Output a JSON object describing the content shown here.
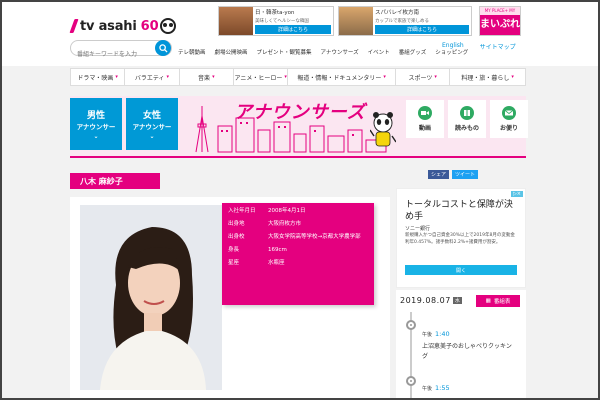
{
  "logo": {
    "text": "tv asahi",
    "sixty": "60"
  },
  "search": {
    "placeholder": "番組キーワードを入力"
  },
  "ads": [
    {
      "title": "日・韓茶ta-yon",
      "desc": "美味しくてヘルシーな韓国",
      "button": "詳細はこちら"
    },
    {
      "title": "スパバレイ枚方南",
      "desc": "カップルで家族で楽しめる",
      "button": "詳細はこちら"
    },
    {
      "top": "MY PLACE+ MY PLEASURE",
      "main": "まいぷれ"
    }
  ],
  "topnav": [
    "テレ朝動画",
    "劇場公開映画",
    "プレゼント・観覧募集",
    "アナウンサーズ",
    "イベント",
    "番組グッズ",
    "ショッピング"
  ],
  "util": {
    "english": "English",
    "sitemap": "サイトマップ"
  },
  "catnav": [
    "ドラマ・映画",
    "バラエティ",
    "音楽",
    "アニメ・ヒーロー",
    "報道・情報・ドキュメンタリー",
    "スポーツ",
    "料理・旅・暮らし"
  ],
  "announcer": {
    "male": {
      "l1": "男性",
      "l2": "アナウンサー"
    },
    "female": {
      "l1": "女性",
      "l2": "アナウンサー"
    },
    "title": "アナウンサーズ",
    "icons": [
      {
        "icon": "video-icon",
        "label": "動画"
      },
      {
        "icon": "book-icon",
        "label": "読みもの"
      },
      {
        "icon": "mail-icon",
        "label": "お便り"
      }
    ]
  },
  "share": {
    "facebook": "シェア",
    "twitter": "ツイート"
  },
  "name": "八木 麻紗子",
  "profile": [
    {
      "key": "入社年月日",
      "value": "2008年4月1日"
    },
    {
      "key": "出身地",
      "value": "大阪府枚方市"
    },
    {
      "key": "出身校",
      "value": "大阪女学院高等学校→京都大学農学部"
    },
    {
      "key": "身長",
      "value": "169cm"
    },
    {
      "key": "星座",
      "value": "水瓶座"
    }
  ],
  "sideAd": {
    "headline": "トータルコストと保障が決め手",
    "sponsor": "ソニー銀行",
    "desc": "新規購入かつ自己資金30%以上で2019年8月の変動金利年0.457%。諸手数料2.2%+諸費用が割安。",
    "button": "開く"
  },
  "schedule": {
    "date": "2019.08.07",
    "day": "水",
    "button": "番組表",
    "items": [
      {
        "ampm": "午後",
        "time": "1:40",
        "title": "上沼恵美子のおしゃべりクッキング"
      },
      {
        "ampm": "午後",
        "time": "1:55",
        "title": ""
      }
    ]
  }
}
